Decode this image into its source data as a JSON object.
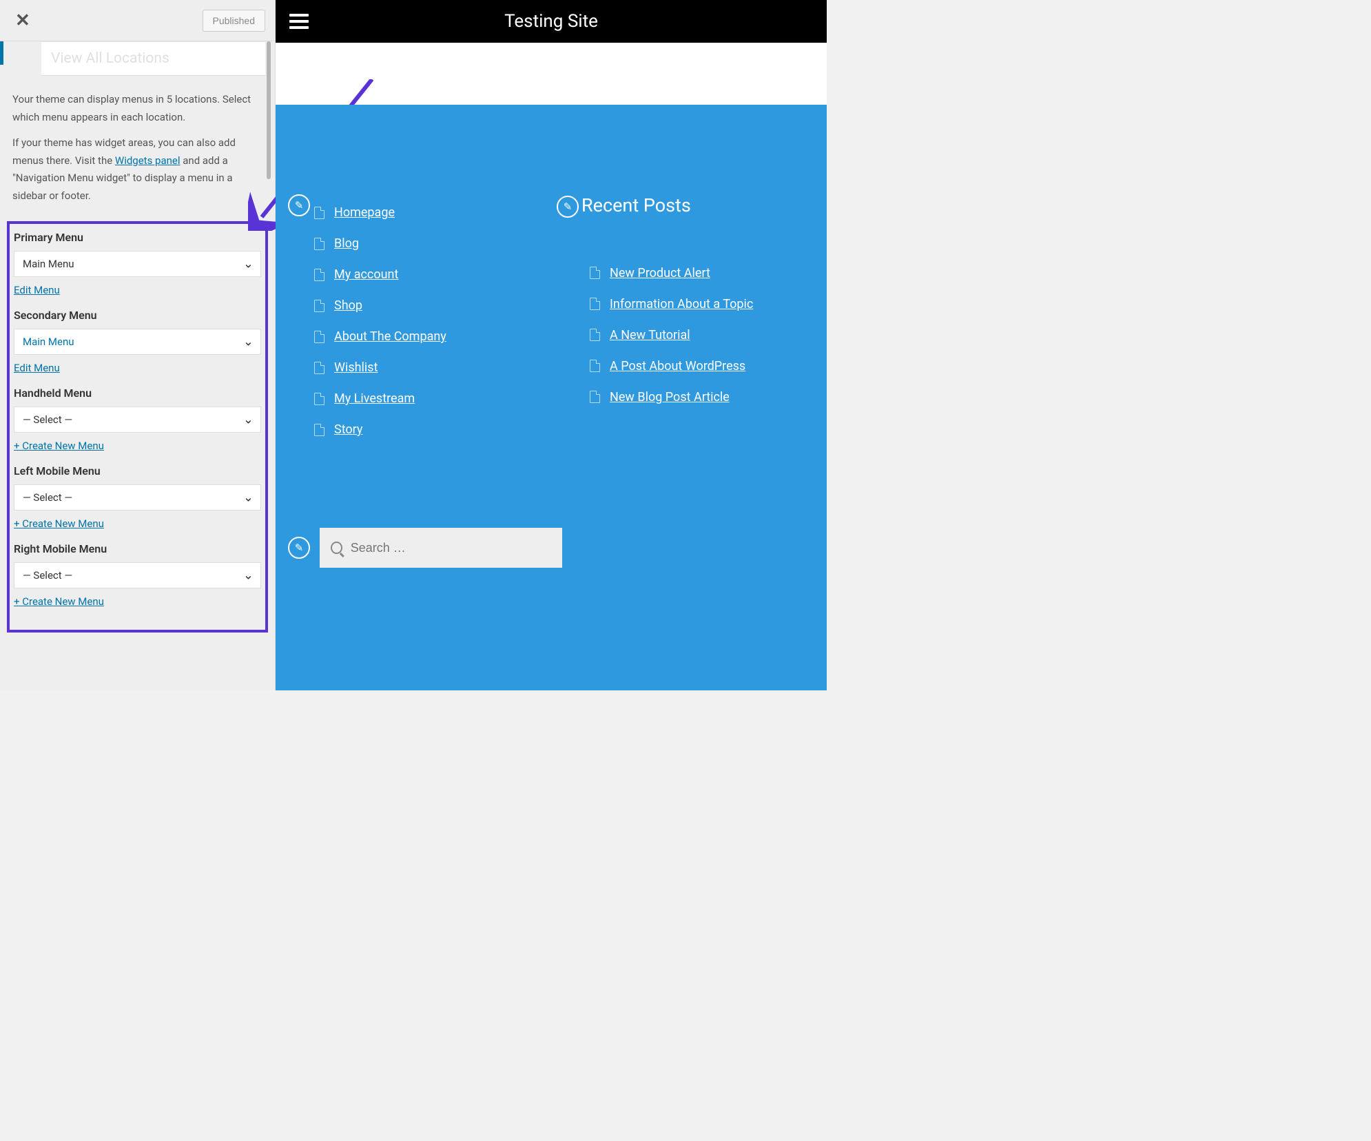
{
  "sidebar": {
    "close_glyph": "✕",
    "published_label": "Published",
    "view_all_label": "View All Locations",
    "help": {
      "p1": "Your theme can display menus in 5 locations. Select which menu appears in each location.",
      "p2a": "If your theme has widget areas, you can also add menus there. Visit the ",
      "widgets_link": "Widgets panel",
      "p2b": " and add a \"Navigation Menu widget\" to display a menu in a sidebar or footer."
    },
    "locations": [
      {
        "label": "Primary Menu",
        "selected": "Main Menu",
        "action_label": "Edit Menu",
        "blue": false
      },
      {
        "label": "Secondary Menu",
        "selected": "Main Menu",
        "action_label": "Edit Menu",
        "blue": true
      },
      {
        "label": "Handheld Menu",
        "selected": "— Select —",
        "action_label": "+ Create New Menu",
        "blue": false
      },
      {
        "label": "Left Mobile Menu",
        "selected": "— Select —",
        "action_label": "+ Create New Menu",
        "blue": false
      },
      {
        "label": "Right Mobile Menu",
        "selected": "— Select —",
        "action_label": "+ Create New Menu",
        "blue": false
      }
    ]
  },
  "preview": {
    "site_title": "Testing Site",
    "nav_links": [
      "Homepage",
      "Blog",
      "My account",
      "Shop",
      "About The Company",
      "Wishlist",
      "My Livestream",
      "Story"
    ],
    "recent_posts_heading": "Recent Posts",
    "recent_posts": [
      "New Product Alert",
      "Information About a Topic",
      "A New Tutorial",
      "A Post About WordPress",
      "New Blog Post Article"
    ],
    "search_placeholder": "Search …",
    "pencil_glyph": "✎"
  }
}
